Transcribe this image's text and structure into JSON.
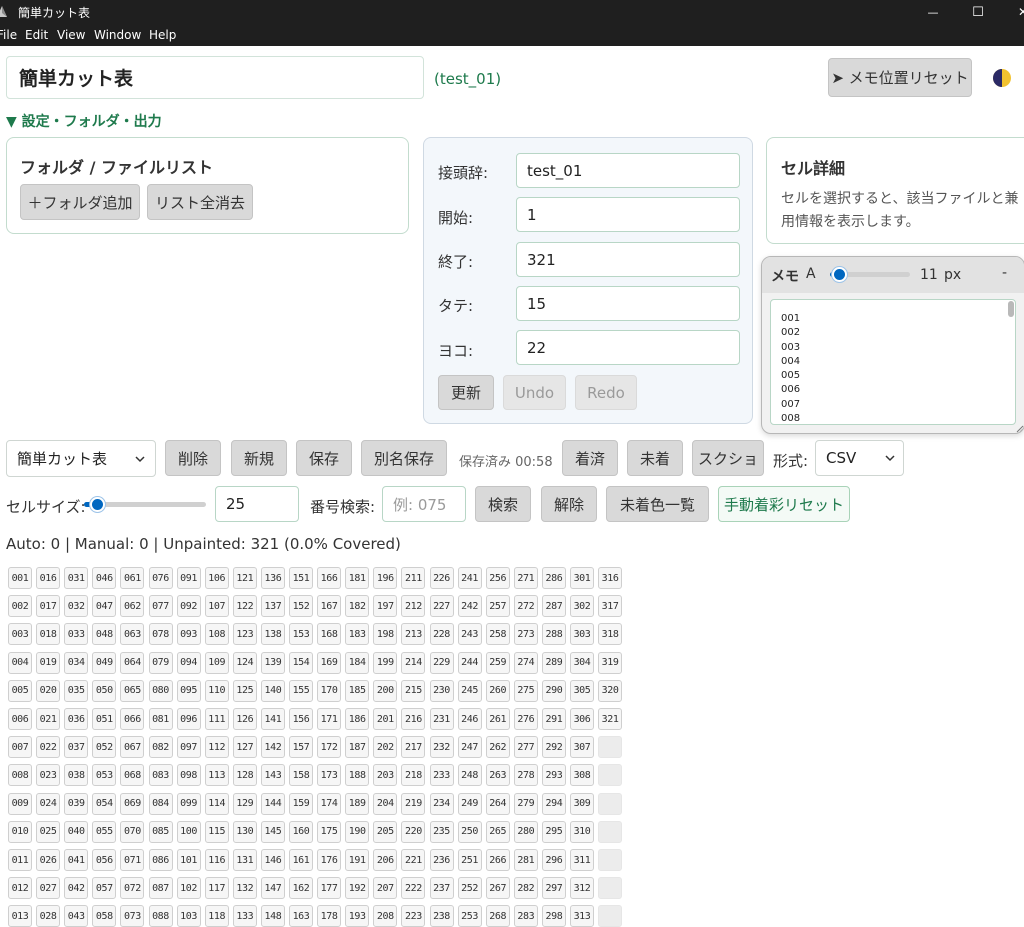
{
  "window": {
    "title": "簡単カット表",
    "menu": [
      "File",
      "Edit",
      "View",
      "Window",
      "Help"
    ],
    "controls": {
      "minimize": "—",
      "maximize": "☐",
      "close": "✕"
    }
  },
  "header": {
    "sheet_title": "簡単カット表",
    "sheet_id": "(test_01)",
    "memo_reset_label": "➤ メモ位置リセット",
    "theme_icon": "half-moon"
  },
  "settings_toggle": "▼ 設定・フォルダ・出力",
  "folder_panel": {
    "title": "フォルダ / ファイルリスト",
    "add_folder_label": "＋フォルダ追加",
    "clear_list_label": "リスト全消去"
  },
  "config": {
    "fields": [
      {
        "label": "接頭辞:",
        "value": "test_01"
      },
      {
        "label": "開始:",
        "value": "1"
      },
      {
        "label": "終了:",
        "value": "321"
      },
      {
        "label": "タテ:",
        "value": "15"
      },
      {
        "label": "ヨコ:",
        "value": "22"
      }
    ],
    "update_label": "更新",
    "undo_label": "Undo",
    "redo_label": "Redo"
  },
  "cell_detail": {
    "title": "セル詳細",
    "body_line1": "セルを選択すると、該当ファイルと兼",
    "body_line2": "用情報を表示します。"
  },
  "memo": {
    "title": "メモ",
    "font_label": "A",
    "font_size": "11",
    "font_unit": "px",
    "font_slider_fraction": 0.08,
    "collapse_label": "-",
    "lines": [
      "001",
      "002",
      "003",
      "004",
      "005",
      "006",
      "007",
      "008"
    ]
  },
  "toolbar": {
    "sheet_select": "簡単カット表",
    "delete_label": "削除",
    "new_label": "新規",
    "save_label": "保存",
    "save_as_label": "別名保存",
    "saved_status": "保存済み 00:58",
    "painted_label": "着済",
    "unpainted_label": "未着",
    "screenshot_label": "スクショ",
    "format_label": "形式:",
    "format_value": "CSV"
  },
  "toolbar2": {
    "cell_size_label": "セルサイズ:",
    "cell_size_slider_fraction": 0.08,
    "cell_size_value": "25",
    "search_label": "番号検索:",
    "search_placeholder": "例: 075",
    "search_button": "検索",
    "clear_button": "解除",
    "uncolored_list_button": "未着色一覧",
    "manual_reset_button": "手動着彩リセット"
  },
  "stats": "Auto: 0 | Manual: 0 | Unpainted: 321 (0.0% Covered)",
  "grid": {
    "rows_per_column": 15,
    "columns": 22,
    "visible_rows": 13,
    "start": 1,
    "end": 321
  },
  "colors": {
    "accent_green": "#1e7a4c",
    "panel_border": "#c3dcce",
    "button_gray": "#d9d9d9",
    "titlebar": "#1f1f1f"
  }
}
